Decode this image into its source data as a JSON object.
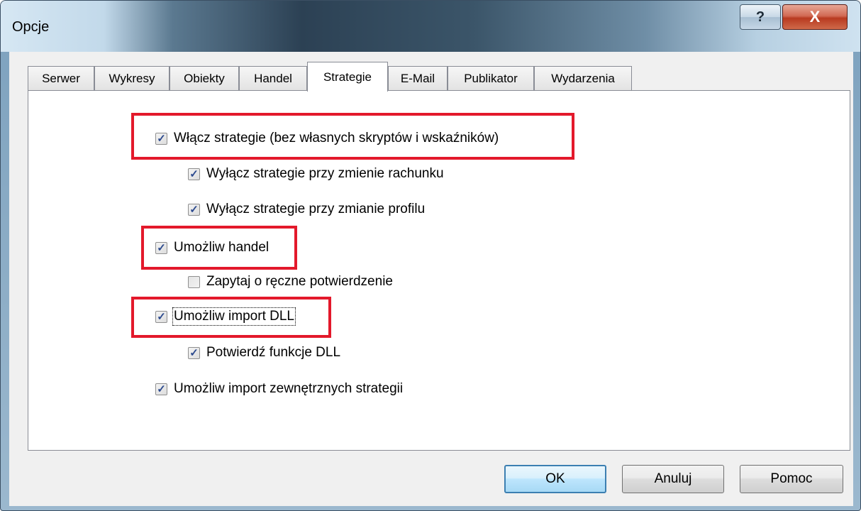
{
  "window": {
    "title": "Opcje",
    "help_label": "?",
    "close_label": "X"
  },
  "tabs": [
    {
      "label": "Serwer"
    },
    {
      "label": "Wykresy"
    },
    {
      "label": "Obiekty"
    },
    {
      "label": "Handel"
    },
    {
      "label": "Strategie",
      "active": true
    },
    {
      "label": "E-Mail"
    },
    {
      "label": "Publikator"
    },
    {
      "label": "Wydarzenia"
    }
  ],
  "options": [
    {
      "label": "Włącz strategie (bez własnych skryptów i wskaźników)",
      "checked": true
    },
    {
      "label": "Wyłącz strategie przy zmienie rachunku",
      "checked": true
    },
    {
      "label": "Wyłącz strategie przy zmianie profilu",
      "checked": true
    },
    {
      "label": "Umożliw handel",
      "checked": true
    },
    {
      "label": "Zapytaj o ręczne potwierdzenie",
      "checked": false
    },
    {
      "label": "Umożliw import DLL",
      "checked": true
    },
    {
      "label": "Potwierdź funkcje DLL",
      "checked": true
    },
    {
      "label": "Umożliw import zewnętrznych strategii",
      "checked": true
    }
  ],
  "buttons": {
    "ok": "OK",
    "cancel": "Anuluj",
    "help": "Pomoc"
  },
  "colors": {
    "highlight": "#e3192b",
    "check": "#2c4a8e",
    "default_button_border": "#3c7fb1"
  }
}
